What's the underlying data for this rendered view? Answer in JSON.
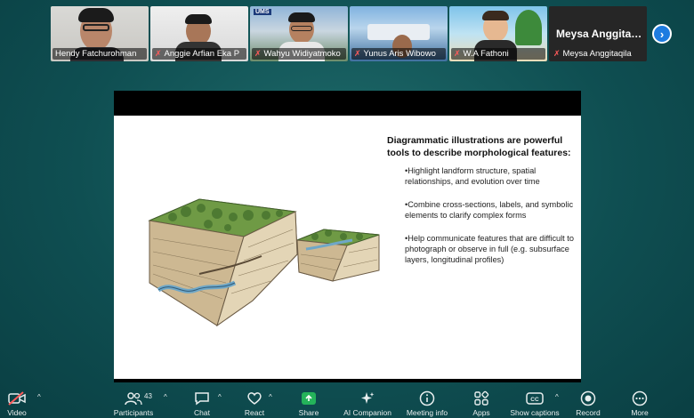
{
  "participants": [
    {
      "name": "Hendy Fatchurohman",
      "muted": false
    },
    {
      "name": "Anggie Arfian Eka P",
      "muted": true
    },
    {
      "name": "Wahyu Widiyatmoko",
      "muted": true,
      "badge": "UMS"
    },
    {
      "name": "Yunus Aris Wibowo",
      "muted": true
    },
    {
      "name": "W.A Fathoni",
      "muted": true
    },
    {
      "name": "Meysa Anggitaqila",
      "muted": true,
      "display_text": "Meysa  Anggitaq..."
    }
  ],
  "slide": {
    "title": "Diagrammatic illustrations are powerful tools to describe morphological features:",
    "bullets": [
      "•Highlight landform structure, spatial relationships, and evolution over time",
      "•Combine cross-sections, labels, and symbolic elements to clarify complex forms",
      "•Help communicate features that are difficult to photograph or observe in full (e.g. subsurface layers, longitudinal profiles)"
    ]
  },
  "toolbar": {
    "video": "Video",
    "participants": "Participants",
    "participants_count": "43",
    "chat": "Chat",
    "react": "React",
    "share": "Share",
    "ai": "AI Companion",
    "meeting_info": "Meeting info",
    "apps": "Apps",
    "captions": "Show captions",
    "record": "Record",
    "more": "More"
  },
  "colors": {
    "accent": "#1e7ce0",
    "share": "#24b35a",
    "active_speaker": "#3ad06a",
    "muted": "#ff5a5a"
  }
}
